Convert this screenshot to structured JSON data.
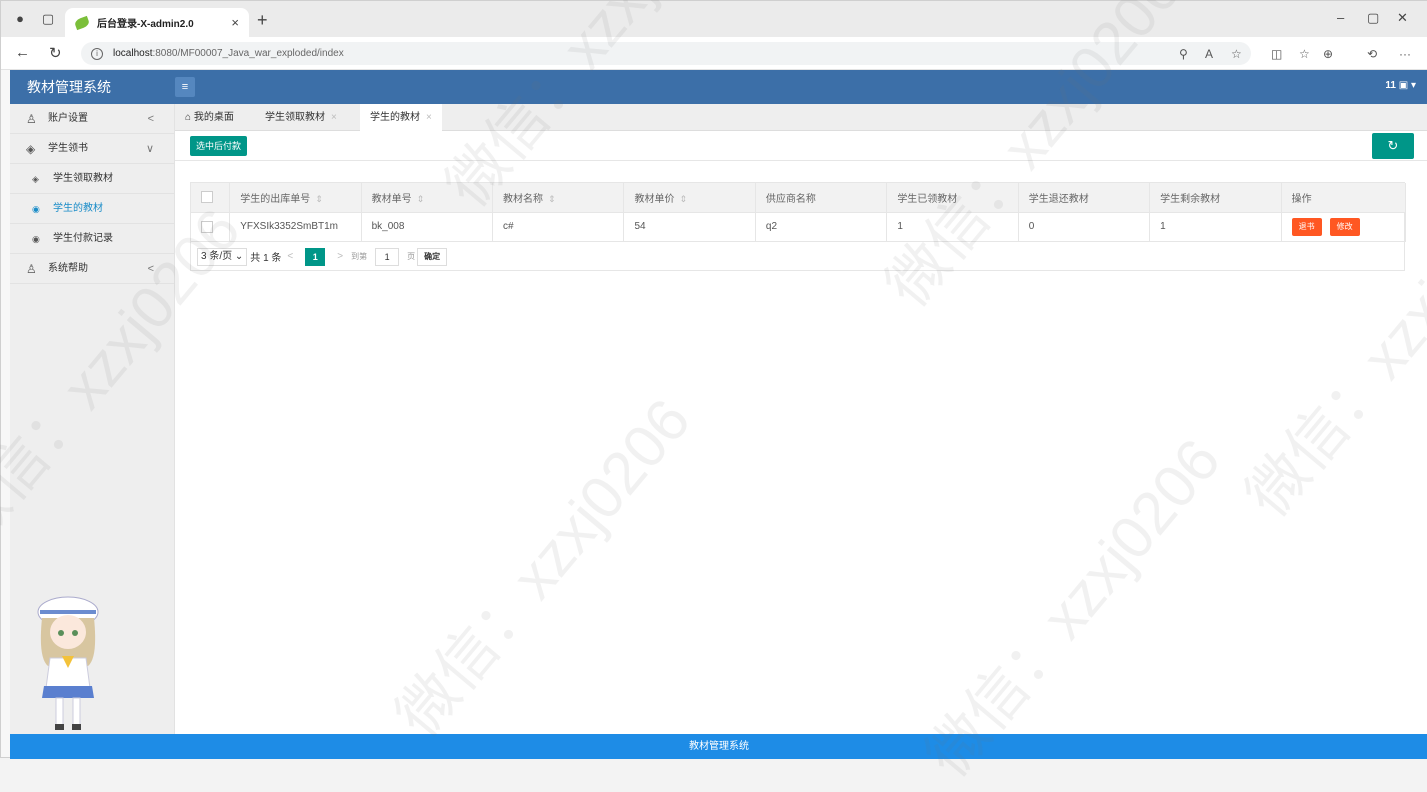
{
  "browser": {
    "tab_title": "后台登录-X-admin2.0",
    "tab_close": "×",
    "new_tab": "+",
    "url_host": "localhost",
    "url_path": ":8080/MF00007_Java_war_exploded/index"
  },
  "app": {
    "title": "教材管理系统",
    "user": "11",
    "menu_toggle": "≡"
  },
  "sidebar": {
    "items": [
      {
        "label": "账户设置",
        "icon": "user-icon",
        "arrow": "<"
      },
      {
        "label": "学生领书",
        "icon": "box-icon",
        "arrow": "∨"
      },
      {
        "label": "学生领取教材",
        "icon": "box-icon"
      },
      {
        "label": "学生的教材",
        "icon": "circle-icon"
      },
      {
        "label": "学生付款记录",
        "icon": "circle-icon"
      },
      {
        "label": "系统帮助",
        "icon": "user-icon",
        "arrow": "<"
      }
    ]
  },
  "tabs": [
    {
      "label": "我的桌面",
      "icon": "home-icon"
    },
    {
      "label": "学生领取教材",
      "close": "×"
    },
    {
      "label": "学生的教材",
      "close": "×"
    }
  ],
  "toolbar": {
    "pay_button": "选中后付款"
  },
  "table": {
    "headers": [
      "学生的出库单号",
      "教材单号",
      "教材名称",
      "教材单价",
      "供应商名称",
      "学生已领教材",
      "学生退还教材",
      "学生剩余教材",
      "操作"
    ],
    "rows": [
      {
        "out_no": "YFXSIk3352SmBT1m",
        "book_no": "bk_008",
        "name": "c#",
        "price": "54",
        "supplier": "q2",
        "received": "1",
        "returned": "0",
        "remaining": "1",
        "action_return": "退书",
        "action_edit": "修改"
      }
    ]
  },
  "pager": {
    "per_page": "3 条/页",
    "total": "共 1 条",
    "current": "1",
    "goto_label": "到第",
    "goto_value": "1",
    "page_unit": "页",
    "confirm": "确定"
  },
  "footer": {
    "text": "教材管理系统"
  },
  "watermark": "微信：xzxj0206",
  "colors": {
    "header": "#3c6fa8",
    "accent": "#009688",
    "danger": "#ff5722",
    "footer": "#1e8ce6"
  }
}
